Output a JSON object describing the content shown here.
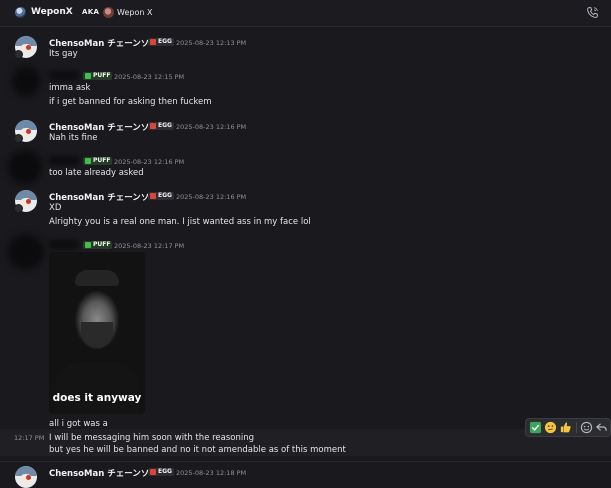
{
  "header": {
    "title": "WeponX",
    "aka_label": "AKA",
    "alias_name": "Wepon X"
  },
  "messages": [
    {
      "author": "ChensoMan チェーンソー",
      "tag": "EGG",
      "timestamp": "2025-08-23 12:13 PM",
      "lines": [
        "Its gay"
      ]
    },
    {
      "author": "",
      "tag": "PUFF",
      "timestamp": "2025-08-23 12:15 PM",
      "lines": [
        "imma ask",
        "if i get banned for asking then fuckem"
      ]
    },
    {
      "author": "ChensoMan チェーンソー",
      "tag": "EGG",
      "timestamp": "2025-08-23 12:16 PM",
      "lines": [
        "Nah its fine"
      ]
    },
    {
      "author": "",
      "tag": "PUFF",
      "timestamp": "2025-08-23 12:16 PM",
      "lines": [
        "too late already asked"
      ]
    },
    {
      "author": "ChensoMan チェーンソー",
      "tag": "EGG",
      "timestamp": "2025-08-23 12:16 PM",
      "lines": [
        "XD",
        "Alrighty you is a real one man. I jist wanted ass in my face lol"
      ]
    },
    {
      "author": "",
      "tag": "PUFF",
      "timestamp": "2025-08-23 12:17 PM",
      "embed_caption": "does it anyway",
      "lines": [
        "all i got was a"
      ]
    },
    {
      "hover_time": "12:17 PM",
      "lines": [
        "I will be messaging him soon with the reasoning",
        "but yes he will be banned and no it not amendable as of this moment"
      ]
    },
    {
      "author": "ChensoMan チェーンソー",
      "tag": "EGG",
      "timestamp": "2025-08-23 12:18 PM",
      "lines": []
    }
  ],
  "toolbar": {
    "actions": [
      "check-reaction",
      "thinking-reaction",
      "thumbs-up-reaction",
      "add-reaction",
      "reply"
    ]
  },
  "colors": {
    "background": "#1a1a1e",
    "egg_tag": "#d9453b",
    "puff_tag": "#3fbf4c",
    "timestamp": "#8e9297"
  }
}
